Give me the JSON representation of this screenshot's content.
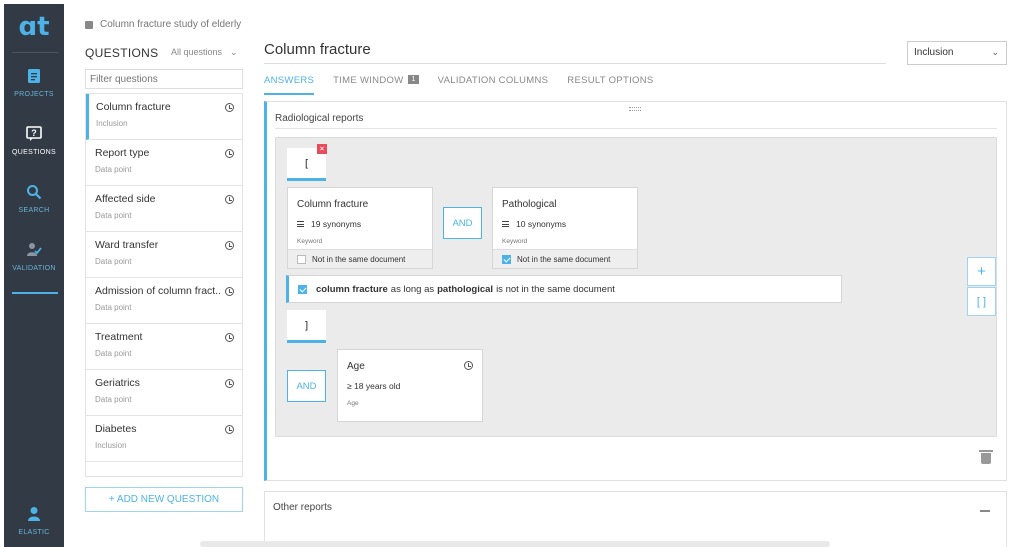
{
  "nav": {
    "logo": "ɑt",
    "items": [
      {
        "label": "PROJECTS",
        "icon": "document-icon"
      },
      {
        "label": "QUESTIONS",
        "icon": "question-icon"
      },
      {
        "label": "SEARCH",
        "icon": "search-icon"
      },
      {
        "label": "VALIDATION",
        "icon": "validation-icon"
      }
    ],
    "user": {
      "label": "ELASTIC",
      "icon": "user-icon"
    },
    "active_index": 1
  },
  "study": {
    "title": "Column fracture study of elderly"
  },
  "questions": {
    "heading": "QUESTIONS",
    "filter_select": "All questions",
    "filter_placeholder": "Filter questions",
    "items": [
      {
        "title": "Column fracture",
        "subtitle": "Inclusion"
      },
      {
        "title": "Report type",
        "subtitle": "Data point"
      },
      {
        "title": "Affected side",
        "subtitle": "Data point"
      },
      {
        "title": "Ward transfer",
        "subtitle": "Data point"
      },
      {
        "title": "Admission of column fract...",
        "subtitle": "Data point"
      },
      {
        "title": "Treatment",
        "subtitle": "Data point"
      },
      {
        "title": "Geriatrics",
        "subtitle": "Data point"
      },
      {
        "title": "Diabetes",
        "subtitle": "Inclusion"
      }
    ],
    "add_button": "+ ADD NEW QUESTION"
  },
  "main": {
    "title": "Column fracture",
    "type_select": "Inclusion",
    "tabs": [
      {
        "label": "ANSWERS",
        "active": true
      },
      {
        "label": "TIME WINDOW",
        "badge": "1"
      },
      {
        "label": "VALIDATION COLUMNS"
      },
      {
        "label": "RESULT OPTIONS"
      }
    ]
  },
  "panel": {
    "title": "Radiological reports",
    "open_bracket": "[",
    "close_bracket": "]",
    "remove_badge": "×",
    "card1": {
      "title": "Column fracture",
      "synonyms": "19 synonyms",
      "kind": "Keyword",
      "footer": "Not in the same document",
      "checked": false
    },
    "and1": "AND",
    "card2": {
      "title": "Pathological",
      "synonyms": "10 synonyms",
      "kind": "Keyword",
      "footer": "Not in the same document",
      "checked": true
    },
    "summary": {
      "term1": "column fracture",
      "mid": "as long as",
      "term2": "pathological",
      "end": "is not in the same document"
    },
    "and2": "AND",
    "age": {
      "title": "Age",
      "value": "≥ 18 years old",
      "kind": "Age"
    },
    "side_add": "+",
    "side_bracket": "[ ]"
  },
  "panel2": {
    "title": "Other reports"
  },
  "colors": {
    "accent": "#4db3e6",
    "nav_bg": "#313a45",
    "danger": "#e84c5c"
  }
}
